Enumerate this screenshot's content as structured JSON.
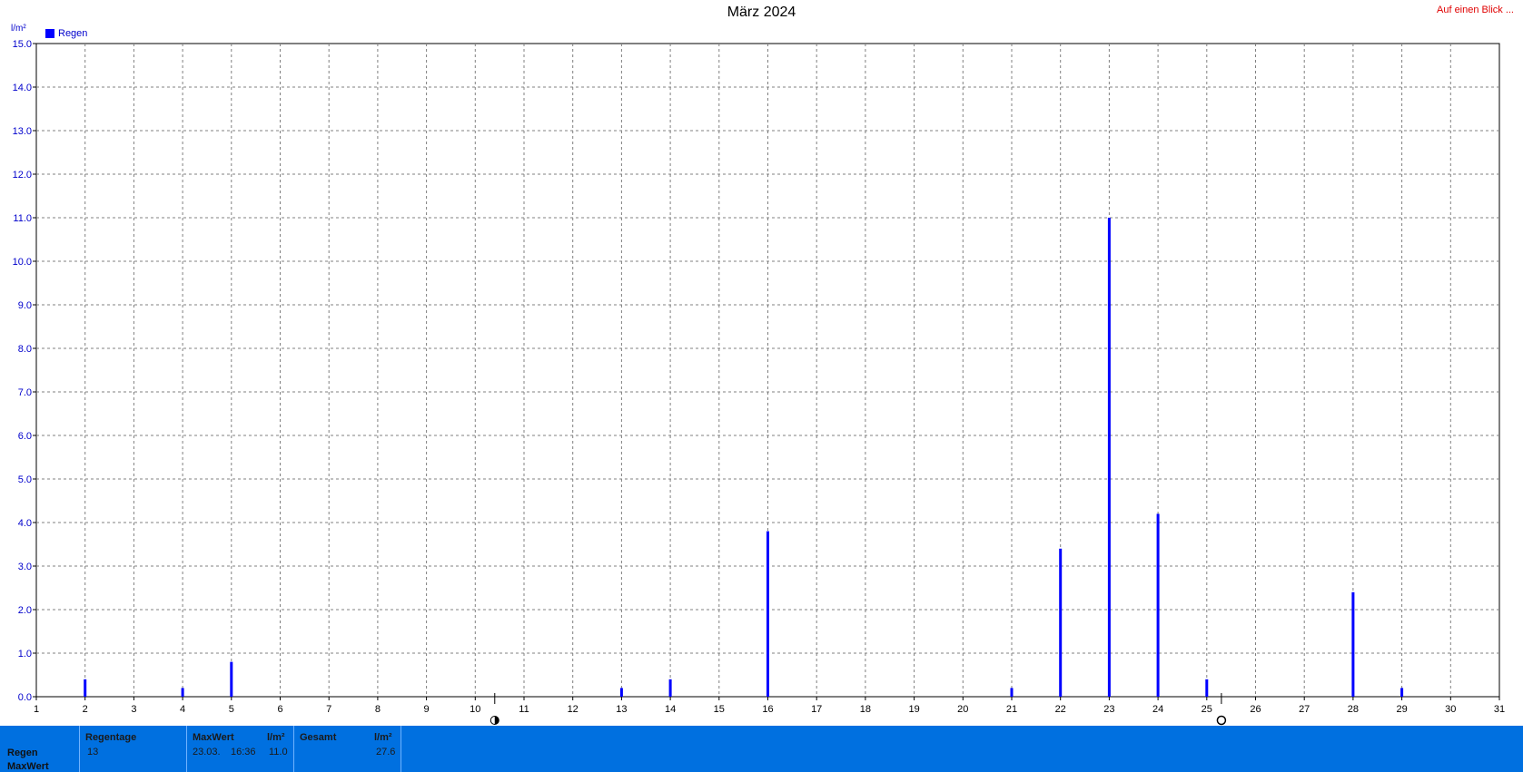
{
  "title": "März 2024",
  "top_link": "Auf einen Blick ...",
  "y_unit": "l/m²",
  "legend": {
    "label": "Regen",
    "color": "#0000ff"
  },
  "colors": {
    "bar": "#0000ff",
    "axis_text": "#0000cc",
    "footer": "#0070e0"
  },
  "chart_data": {
    "type": "bar",
    "legend": [
      "Regen"
    ],
    "ylabel": "l/m²",
    "ylim": [
      0,
      15
    ],
    "yticks": [
      "0.0",
      "1.0",
      "2.0",
      "3.0",
      "4.0",
      "5.0",
      "6.0",
      "7.0",
      "8.0",
      "9.0",
      "10.0",
      "11.0",
      "12.0",
      "13.0",
      "14.0",
      "15.0"
    ],
    "xlim": [
      1,
      31
    ],
    "xticks": [
      "1",
      "2",
      "3",
      "4",
      "5",
      "6",
      "7",
      "8",
      "9",
      "10",
      "11",
      "12",
      "13",
      "14",
      "15",
      "16",
      "17",
      "18",
      "19",
      "20",
      "21",
      "22",
      "23",
      "24",
      "25",
      "26",
      "27",
      "28",
      "29",
      "30",
      "31"
    ],
    "grid": true,
    "moon_markers": [
      {
        "day": 10.4,
        "icon": "full-moon-icon"
      },
      {
        "day": 25.3,
        "icon": "new-moon-icon"
      }
    ],
    "series": [
      {
        "name": "Regen",
        "points": [
          {
            "x": 2,
            "y": 0.4
          },
          {
            "x": 4,
            "y": 0.2
          },
          {
            "x": 5,
            "y": 0.8
          },
          {
            "x": 13,
            "y": 0.2
          },
          {
            "x": 14,
            "y": 0.4
          },
          {
            "x": 16,
            "y": 3.8
          },
          {
            "x": 21,
            "y": 0.2
          },
          {
            "x": 22,
            "y": 3.4
          },
          {
            "x": 23,
            "y": 11.0
          },
          {
            "x": 24,
            "y": 4.2
          },
          {
            "x": 25,
            "y": 0.4
          },
          {
            "x": 28,
            "y": 2.4
          },
          {
            "x": 29,
            "y": 0.2
          }
        ]
      }
    ]
  },
  "footer": {
    "row_labels": [
      "Regen",
      "MaxWert"
    ],
    "regentage": {
      "header": "Regentage",
      "value": "13"
    },
    "maxwert": {
      "header": "MaxWert",
      "unit": "l/m²",
      "date": "23.03.",
      "time": "16:36",
      "value": "11.0"
    },
    "gesamt": {
      "header": "Gesamt",
      "unit": "l/m²",
      "value": "27.6"
    }
  }
}
